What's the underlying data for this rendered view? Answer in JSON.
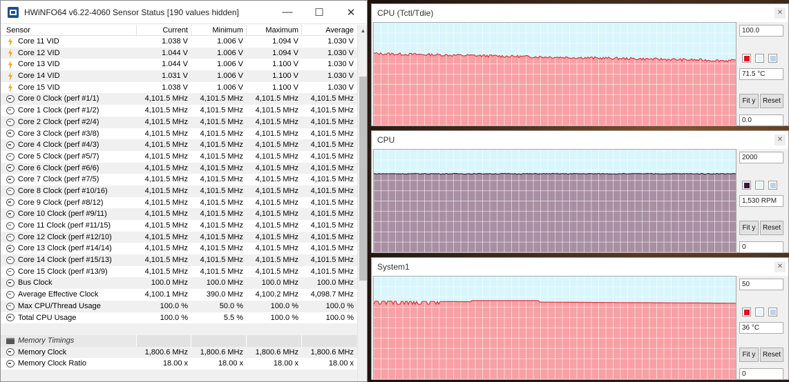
{
  "hwinfo": {
    "title": "HWiNFO64 v6.22-4060 Sensor Status [190 values hidden]",
    "columns": [
      "Sensor",
      "Current",
      "Minimum",
      "Maximum",
      "Average"
    ],
    "rows": [
      {
        "type": "volt",
        "name": "Core 11 VID",
        "cur": "1.038 V",
        "min": "1.006 V",
        "max": "1.094 V",
        "avg": "1.030 V"
      },
      {
        "type": "volt",
        "name": "Core 12 VID",
        "cur": "1.044 V",
        "min": "1.006 V",
        "max": "1.094 V",
        "avg": "1.030 V"
      },
      {
        "type": "volt",
        "name": "Core 13 VID",
        "cur": "1.044 V",
        "min": "1.006 V",
        "max": "1.100 V",
        "avg": "1.030 V"
      },
      {
        "type": "volt",
        "name": "Core 14 VID",
        "cur": "1.031 V",
        "min": "1.006 V",
        "max": "1.100 V",
        "avg": "1.030 V"
      },
      {
        "type": "volt",
        "name": "Core 15 VID",
        "cur": "1.038 V",
        "min": "1.006 V",
        "max": "1.100 V",
        "avg": "1.030 V"
      },
      {
        "type": "clock",
        "name": "Core 0 Clock (perf #1/1)",
        "cur": "4,101.5 MHz",
        "min": "4,101.5 MHz",
        "max": "4,101.5 MHz",
        "avg": "4,101.5 MHz"
      },
      {
        "type": "clock",
        "name": "Core 1 Clock (perf #1/2)",
        "cur": "4,101.5 MHz",
        "min": "4,101.5 MHz",
        "max": "4,101.5 MHz",
        "avg": "4,101.5 MHz"
      },
      {
        "type": "clock",
        "name": "Core 2 Clock (perf #2/4)",
        "cur": "4,101.5 MHz",
        "min": "4,101.5 MHz",
        "max": "4,101.5 MHz",
        "avg": "4,101.5 MHz"
      },
      {
        "type": "clock",
        "name": "Core 3 Clock (perf #3/8)",
        "cur": "4,101.5 MHz",
        "min": "4,101.5 MHz",
        "max": "4,101.5 MHz",
        "avg": "4,101.5 MHz"
      },
      {
        "type": "clock",
        "name": "Core 4 Clock (perf #4/3)",
        "cur": "4,101.5 MHz",
        "min": "4,101.5 MHz",
        "max": "4,101.5 MHz",
        "avg": "4,101.5 MHz"
      },
      {
        "type": "clock",
        "name": "Core 5 Clock (perf #5/7)",
        "cur": "4,101.5 MHz",
        "min": "4,101.5 MHz",
        "max": "4,101.5 MHz",
        "avg": "4,101.5 MHz"
      },
      {
        "type": "clock",
        "name": "Core 6 Clock (perf #6/6)",
        "cur": "4,101.5 MHz",
        "min": "4,101.5 MHz",
        "max": "4,101.5 MHz",
        "avg": "4,101.5 MHz"
      },
      {
        "type": "clock",
        "name": "Core 7 Clock (perf #7/5)",
        "cur": "4,101.5 MHz",
        "min": "4,101.5 MHz",
        "max": "4,101.5 MHz",
        "avg": "4,101.5 MHz"
      },
      {
        "type": "clock",
        "name": "Core 8 Clock (perf #10/16)",
        "cur": "4,101.5 MHz",
        "min": "4,101.5 MHz",
        "max": "4,101.5 MHz",
        "avg": "4,101.5 MHz"
      },
      {
        "type": "clock",
        "name": "Core 9 Clock (perf #8/12)",
        "cur": "4,101.5 MHz",
        "min": "4,101.5 MHz",
        "max": "4,101.5 MHz",
        "avg": "4,101.5 MHz"
      },
      {
        "type": "clock",
        "name": "Core 10 Clock (perf #9/11)",
        "cur": "4,101.5 MHz",
        "min": "4,101.5 MHz",
        "max": "4,101.5 MHz",
        "avg": "4,101.5 MHz"
      },
      {
        "type": "clock",
        "name": "Core 11 Clock (perf #11/15)",
        "cur": "4,101.5 MHz",
        "min": "4,101.5 MHz",
        "max": "4,101.5 MHz",
        "avg": "4,101.5 MHz"
      },
      {
        "type": "clock",
        "name": "Core 12 Clock (perf #12/10)",
        "cur": "4,101.5 MHz",
        "min": "4,101.5 MHz",
        "max": "4,101.5 MHz",
        "avg": "4,101.5 MHz"
      },
      {
        "type": "clock",
        "name": "Core 13 Clock (perf #14/14)",
        "cur": "4,101.5 MHz",
        "min": "4,101.5 MHz",
        "max": "4,101.5 MHz",
        "avg": "4,101.5 MHz"
      },
      {
        "type": "clock",
        "name": "Core 14 Clock (perf #15/13)",
        "cur": "4,101.5 MHz",
        "min": "4,101.5 MHz",
        "max": "4,101.5 MHz",
        "avg": "4,101.5 MHz"
      },
      {
        "type": "clock",
        "name": "Core 15 Clock (perf #13/9)",
        "cur": "4,101.5 MHz",
        "min": "4,101.5 MHz",
        "max": "4,101.5 MHz",
        "avg": "4,101.5 MHz"
      },
      {
        "type": "clock",
        "name": "Bus Clock",
        "cur": "100.0 MHz",
        "min": "100.0 MHz",
        "max": "100.0 MHz",
        "avg": "100.0 MHz"
      },
      {
        "type": "clock",
        "name": "Average Effective Clock",
        "cur": "4,100.1 MHz",
        "min": "390.0 MHz",
        "max": "4,100.2 MHz",
        "avg": "4,098.7 MHz"
      },
      {
        "type": "clock",
        "name": "Max CPU/Thread Usage",
        "cur": "100.0 %",
        "min": "50.0 %",
        "max": "100.0 %",
        "avg": "100.0 %"
      },
      {
        "type": "clock",
        "name": "Total CPU Usage",
        "cur": "100.0 %",
        "min": "5.5 %",
        "max": "100.0 %",
        "avg": "100.0 %"
      },
      {
        "type": "blank",
        "name": "",
        "cur": "",
        "min": "",
        "max": "",
        "avg": ""
      },
      {
        "type": "section",
        "name": "Memory Timings",
        "cur": "",
        "min": "",
        "max": "",
        "avg": ""
      },
      {
        "type": "clock",
        "name": "Memory Clock",
        "cur": "1,800.6 MHz",
        "min": "1,800.6 MHz",
        "max": "1,800.6 MHz",
        "avg": "1,800.6 MHz"
      },
      {
        "type": "clock",
        "name": "Memory Clock Ratio",
        "cur": "18.00 x",
        "min": "18.00 x",
        "max": "18.00 x",
        "avg": "18.00 x"
      },
      {
        "type": "blank",
        "name": "",
        "cur": "",
        "min": "",
        "max": "",
        "avg": ""
      }
    ]
  },
  "graphs": [
    {
      "title": "CPU (Tctl/Tdie)",
      "top": "100.0",
      "current": "71.5 °C",
      "bottom": "0.0",
      "fit": "Fit y",
      "reset": "Reset",
      "fill": "#f8a0a4",
      "line": "#e0303a",
      "swatch": "#e01020",
      "level": 0.7,
      "noise": 0.012,
      "trend": -0.07
    },
    {
      "title": "CPU",
      "top": "2000",
      "current": "1,530 RPM",
      "bottom": "0",
      "fit": "Fit y",
      "reset": "Reset",
      "fill": "#a98fa3",
      "line": "#3a1a3a",
      "swatch": "#3a1a3a",
      "level": 0.765,
      "noise": 0.004,
      "trend": 0.0
    },
    {
      "title": "System1",
      "top": "50",
      "current": "36 °C",
      "bottom": "0",
      "fit": "Fit y",
      "reset": "Reset",
      "fill": "#f8a0a4",
      "line": "#e0303a",
      "swatch": "#e01020",
      "level": 0.76,
      "noise": 0.0,
      "trend": -0.02
    }
  ]
}
